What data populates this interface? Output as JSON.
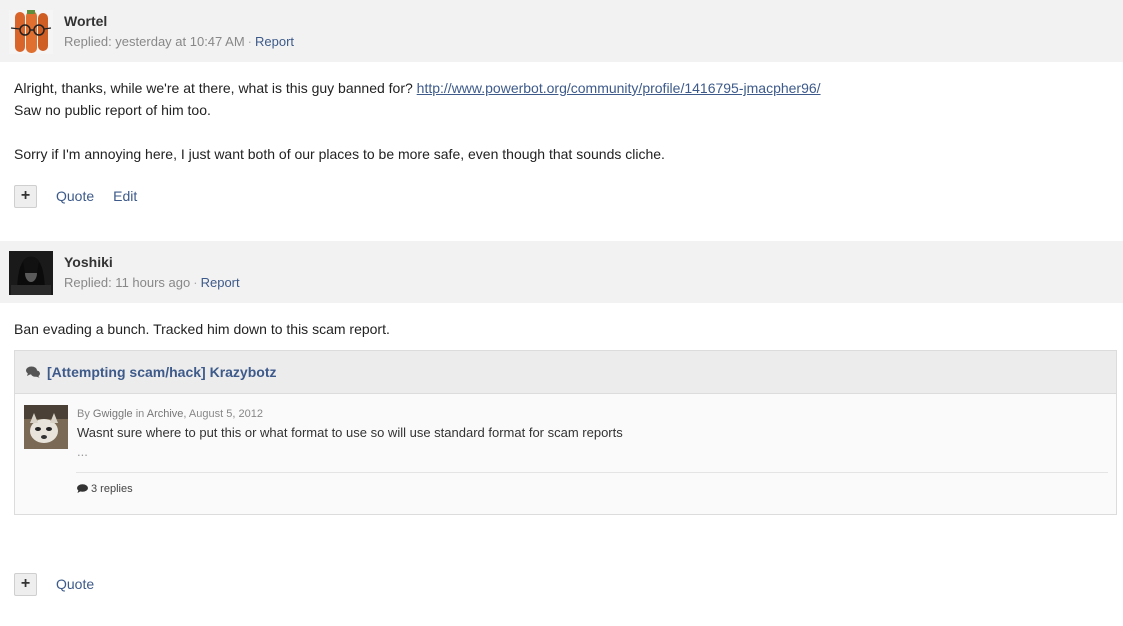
{
  "posts": [
    {
      "author": "Wortel",
      "replied": "Replied: yesterday at 10:47 AM",
      "report_label": "Report",
      "lines": [
        "Alright, thanks, while we're at there, what is this guy banned for? ",
        "Saw no public report of him too.",
        "Sorry if I'm annoying here, I just want both of our places to be more safe, even though that sounds cliche."
      ],
      "link": "http://www.powerbot.org/community/profile/1416795-jmacpher96/",
      "actions": {
        "plus": "+",
        "quote": "Quote",
        "edit": "Edit"
      }
    },
    {
      "author": "Yoshiki",
      "replied": "Replied: 11 hours ago",
      "report_label": "Report",
      "body": "Ban evading a bunch. Tracked him down to this scam report.",
      "embed": {
        "title": "[Attempting scam/hack] Krazybotz",
        "by_prefix": "By ",
        "by_author": "Gwiggle",
        "in_prefix": " in ",
        "forum": "Archive",
        "date": ", August 5, 2012",
        "snippet": "Wasnt sure where to put this or what format to use so will use standard format for scam reports",
        "ellipsis": "...",
        "replies": "3 replies"
      },
      "actions": {
        "plus": "+",
        "quote": "Quote"
      }
    }
  ],
  "colors": {
    "link": "#3d5a8a",
    "header_bg": "#f2f2f2"
  }
}
